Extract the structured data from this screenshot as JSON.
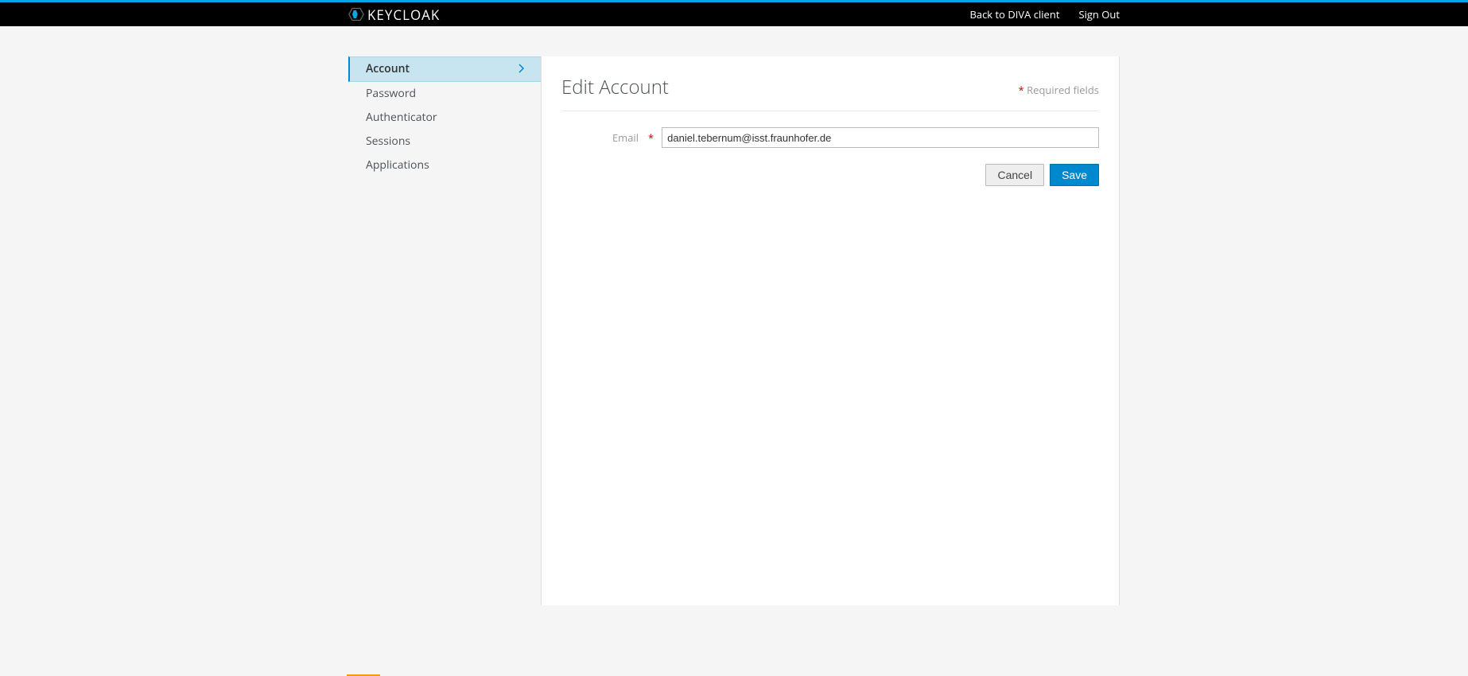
{
  "header": {
    "brand": "KEYCLOAK",
    "links": {
      "back": "Back to DIVA client",
      "signout": "Sign Out"
    }
  },
  "sidebar": {
    "items": [
      {
        "label": "Account",
        "active": true
      },
      {
        "label": "Password",
        "active": false
      },
      {
        "label": "Authenticator",
        "active": false
      },
      {
        "label": "Sessions",
        "active": false
      },
      {
        "label": "Applications",
        "active": false
      }
    ]
  },
  "main": {
    "title": "Edit Account",
    "required_label": "Required fields",
    "form": {
      "email_label": "Email",
      "email_value": "daniel.tebernum@isst.fraunhofer.de"
    },
    "actions": {
      "cancel": "Cancel",
      "save": "Save"
    }
  },
  "colors": {
    "accent": "#00a8e1",
    "primary": "#0088ce",
    "required": "#c00"
  }
}
